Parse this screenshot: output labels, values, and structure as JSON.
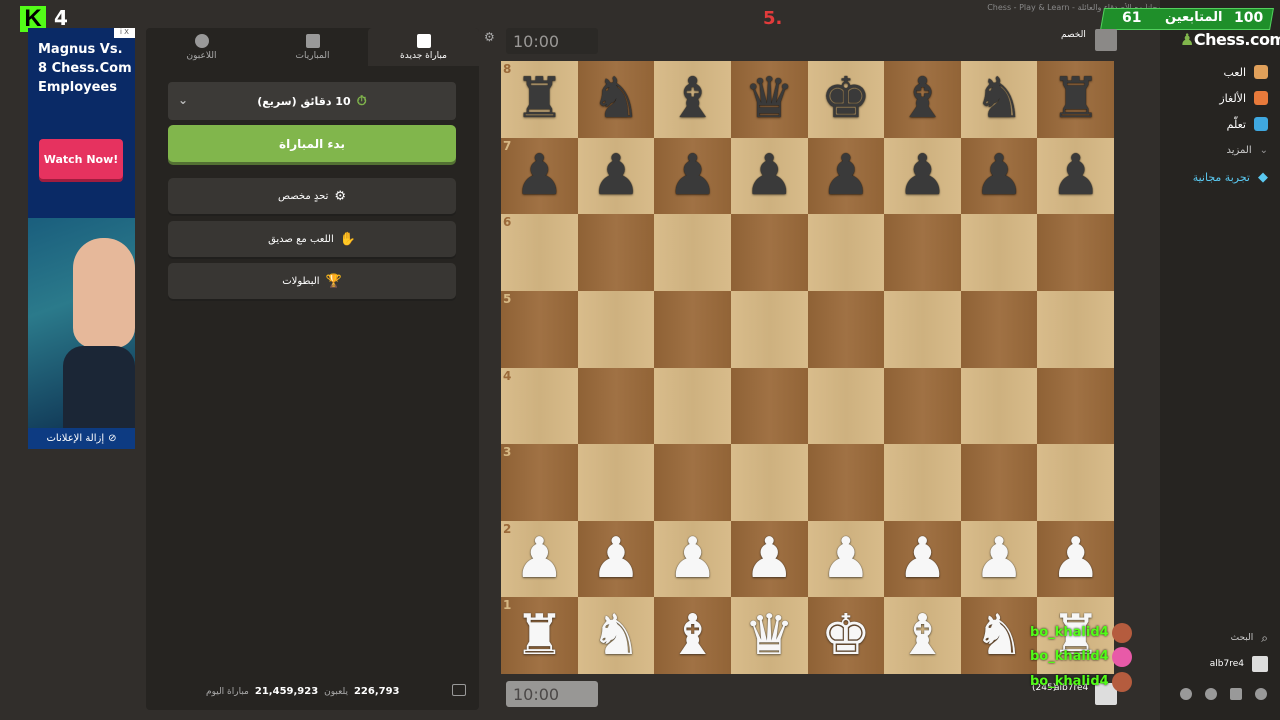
{
  "window_title": "Chess - Play & Learn - العب شطرنج مجاناً مع الأصدقاء والعائلة - Chess.com",
  "overlay": {
    "kick_logo": "K",
    "kick_count": "4",
    "red_marker": "5.",
    "followers_count": "61",
    "followers_label": "المتابعين",
    "goal": "100"
  },
  "nav": {
    "logo": "Chess.com",
    "items": [
      {
        "label": "العب",
        "icon": "play-icon",
        "color": "#e0a05a"
      },
      {
        "label": "الألغاز",
        "icon": "puzzle-icon",
        "color": "#e87a3b"
      },
      {
        "label": "تعلّم",
        "icon": "learn-icon",
        "color": "#3fa8e0"
      },
      {
        "label": "المزيد",
        "icon": "chevron-down-icon",
        "color": "#999999"
      },
      {
        "label": "تجربة مجانية",
        "icon": "diamond-icon",
        "color": "#5ac8f0"
      }
    ],
    "search_label": "البحث",
    "username": "alb7re4"
  },
  "ad": {
    "badge": "i X",
    "text": "Magnus Vs. 8 Chess.Com Employees",
    "cta": "Watch Now!",
    "remove_ads": "إزالة الإعلانات"
  },
  "panel": {
    "tabs": [
      {
        "label": "مباراة جديدة",
        "active": true
      },
      {
        "label": "المباريات",
        "active": false
      },
      {
        "label": "اللاعبون",
        "active": false
      }
    ],
    "time_control": "10 دقائق (سريع)",
    "play_button": "بدء المباراة",
    "options": [
      {
        "label": "تحدٍ مخصص",
        "icon": "custom-challenge-icon"
      },
      {
        "label": "اللعب مع صديق",
        "icon": "handshake-icon"
      },
      {
        "label": "البطولات",
        "icon": "trophy-icon"
      }
    ],
    "stats": {
      "players_value": "226,793",
      "players_label": "يلعبون",
      "games_value": "21,459,923",
      "games_label": "مباراة اليوم"
    }
  },
  "game": {
    "top_clock": "10:00",
    "bottom_clock": "10:00",
    "opponent_label": "الخصم",
    "player_name": "alb7re4",
    "player_rating": "(245)",
    "ranks": [
      "8",
      "7",
      "6",
      "5",
      "4",
      "3",
      "2",
      "1"
    ],
    "board": [
      [
        "♜",
        "♞",
        "♝",
        "♛",
        "♚",
        "♝",
        "♞",
        "♜"
      ],
      [
        "♟",
        "♟",
        "♟",
        "♟",
        "♟",
        "♟",
        "♟",
        "♟"
      ],
      [
        "",
        "",
        "",
        "",
        "",
        "",
        "",
        ""
      ],
      [
        "",
        "",
        "",
        "",
        "",
        "",
        "",
        ""
      ],
      [
        "",
        "",
        "",
        "",
        "",
        "",
        "",
        ""
      ],
      [
        "",
        "",
        "",
        "",
        "",
        "",
        "",
        ""
      ],
      [
        "♟",
        "♟",
        "♟",
        "♟",
        "♟",
        "♟",
        "♟",
        "♟"
      ],
      [
        "♜",
        "♞",
        "♝",
        "♛",
        "♚",
        "♝",
        "♞",
        "♜"
      ]
    ]
  },
  "chat": [
    {
      "user": "bo_khalid4"
    },
    {
      "user": "bo_khalid4"
    },
    {
      "user": "bo_khalid4"
    }
  ]
}
